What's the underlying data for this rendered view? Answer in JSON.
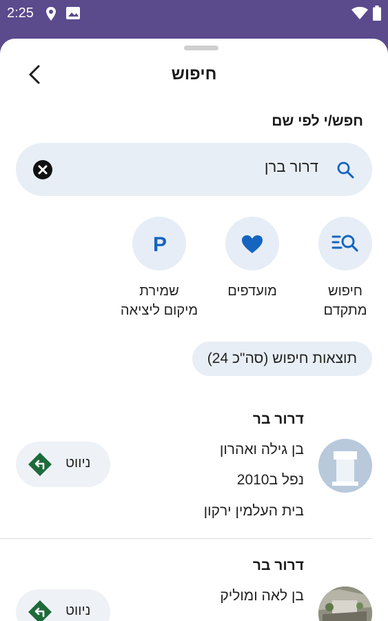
{
  "status_bar": {
    "time": "2:25"
  },
  "header": {
    "title": "חיפוש"
  },
  "search": {
    "section_label": "חפש/י לפי שם",
    "value": "דרור ברן"
  },
  "quick_actions": [
    {
      "label_line1": "חיפוש",
      "label_line2": "מתקדם",
      "icon": "advanced-search-icon"
    },
    {
      "label_line1": "מועדפים",
      "label_line2": "",
      "icon": "heart-icon"
    },
    {
      "label_line1": "שמירת",
      "label_line2": "מיקום ליציאה",
      "icon": "parking-icon"
    }
  ],
  "results_chip": "תוצאות חיפוש (סה\"כ 24)",
  "results": [
    {
      "name": "דרור בר",
      "line1": "בן גילה ואהרון",
      "line2": "נפל ב2010",
      "line3": "בית העלמין ירקון",
      "nav_label": "ניווט"
    },
    {
      "name": "דרור בר",
      "line1": "בן לאה ומוליק",
      "line2": "",
      "line3": "",
      "nav_label": "ניווט"
    }
  ],
  "colors": {
    "accent": "#5b4a8c",
    "primary_blue": "#1565c0",
    "nav_green": "#1e6b3a"
  }
}
